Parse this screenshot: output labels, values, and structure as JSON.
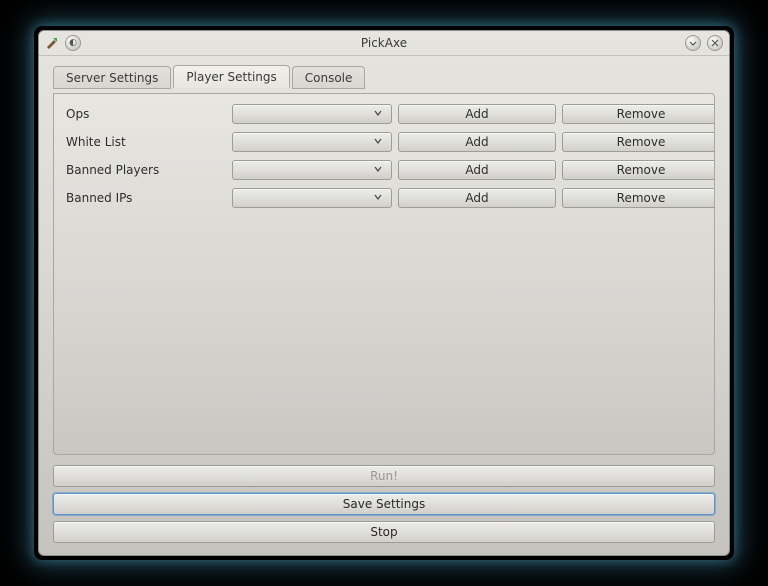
{
  "window": {
    "title": "PickAxe"
  },
  "tabs": [
    {
      "label": "Server Settings"
    },
    {
      "label": "Player Settings"
    },
    {
      "label": "Console"
    }
  ],
  "active_tab_index": 1,
  "rows": [
    {
      "label": "Ops",
      "selected": "",
      "add": "Add",
      "remove": "Remove"
    },
    {
      "label": "White List",
      "selected": "",
      "add": "Add",
      "remove": "Remove"
    },
    {
      "label": "Banned Players",
      "selected": "",
      "add": "Add",
      "remove": "Remove"
    },
    {
      "label": "Banned IPs",
      "selected": "",
      "add": "Add",
      "remove": "Remove"
    }
  ],
  "buttons": {
    "run": "Run!",
    "save": "Save Settings",
    "stop": "Stop"
  },
  "run_enabled": false
}
